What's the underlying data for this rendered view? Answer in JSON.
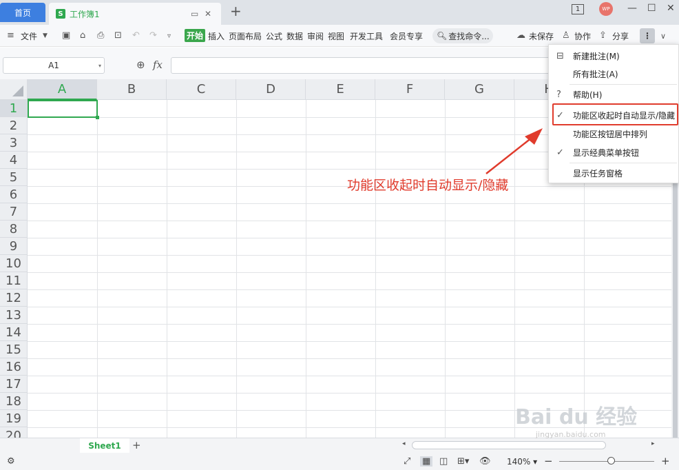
{
  "tabs": {
    "home": "首页",
    "doc_icon": "S",
    "doc_title": "工作簿1"
  },
  "window": {
    "page_count": "1",
    "avatar": "WP"
  },
  "menubar": {
    "file": "文件",
    "items": [
      "开始",
      "插入",
      "页面布局",
      "公式",
      "数据",
      "审阅",
      "视图",
      "开发工具",
      "会员专享"
    ],
    "search": "查找命令...",
    "unsaved": "未保存",
    "collab": "协作",
    "share": "分享"
  },
  "formula": {
    "cell_ref": "A1",
    "fx": "fx"
  },
  "columns": [
    "A",
    "B",
    "C",
    "D",
    "E",
    "F",
    "G",
    "H"
  ],
  "rows": [
    "1",
    "2",
    "3",
    "4",
    "5",
    "6",
    "7",
    "8",
    "9",
    "10",
    "11",
    "12",
    "13",
    "14",
    "15",
    "16",
    "17",
    "18",
    "19",
    "20"
  ],
  "sheet": {
    "name": "Sheet1"
  },
  "status": {
    "zoom": "140%"
  },
  "dropdown": {
    "items": [
      {
        "label": "新建批注(M)",
        "checked": false,
        "icon": "comment-icon"
      },
      {
        "label": "所有批注(A)",
        "checked": false,
        "icon": ""
      },
      {
        "label": "帮助(H)",
        "checked": false,
        "icon": "help-icon"
      },
      {
        "label": "功能区收起时自动显示/隐藏",
        "checked": true,
        "icon": "check-icon"
      },
      {
        "label": "功能区按钮居中排列",
        "checked": false,
        "icon": ""
      },
      {
        "label": "显示经典菜单按钮",
        "checked": true,
        "icon": "check-icon"
      },
      {
        "label": "显示任务窗格",
        "checked": false,
        "icon": ""
      }
    ]
  },
  "annotation": {
    "text": "功能区收起时自动显示/隐藏",
    "color": "#e03b2c"
  },
  "watermark": {
    "brand": "Bai du 经验",
    "url": "jingyan.baidu.com"
  },
  "colors": {
    "accent": "#2fa84f",
    "home_tab": "#3d7fe0",
    "annotation": "#e03b2c"
  }
}
